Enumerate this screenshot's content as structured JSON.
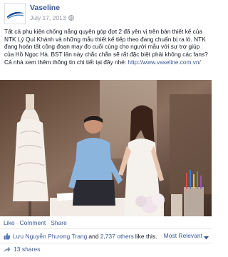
{
  "page": {
    "name": "Vaseline",
    "date": "July 17, 2013",
    "colors": {
      "link": "#3b5998",
      "text": "#141823",
      "meta": "#90949c",
      "brand": "#1b4f93"
    }
  },
  "post": {
    "paragraph_1": "Tất cả phụ kiện chống nắng quyên góp đợt 2 đã yên vị trên bàn thiết kế của NTK Lý Quí Khánh và những mẫu thiết kế tiếp theo đang chuẩn bị ra lò. NTK đang hoàn tất công đoạn may đo cuối cùng cho người mẫu với sự trợ giúp của Hồ Ngọc Hà. BST lần này chắc chắn sẽ rất đặc biệt phải không các fans?",
    "paragraph_2_prefix": "Cả nhà xem thêm thông tin chi tiết tại đây nhé: ",
    "link": "http://www.vaseline.com.vn/"
  },
  "actions": {
    "like": "Like",
    "comment": "Comment",
    "share": "Share",
    "separator": "·"
  },
  "likes": {
    "liker": "Lưu Nguyễn Phương Trang",
    "and": "and",
    "others": "2,737 others",
    "suffix": "like this.",
    "sort_label": "Most Relevant"
  },
  "shares": {
    "label": "13 shares"
  },
  "icons": [
    "globe-icon",
    "like-thumb-icon",
    "caret-down-icon",
    "share-icon"
  ]
}
